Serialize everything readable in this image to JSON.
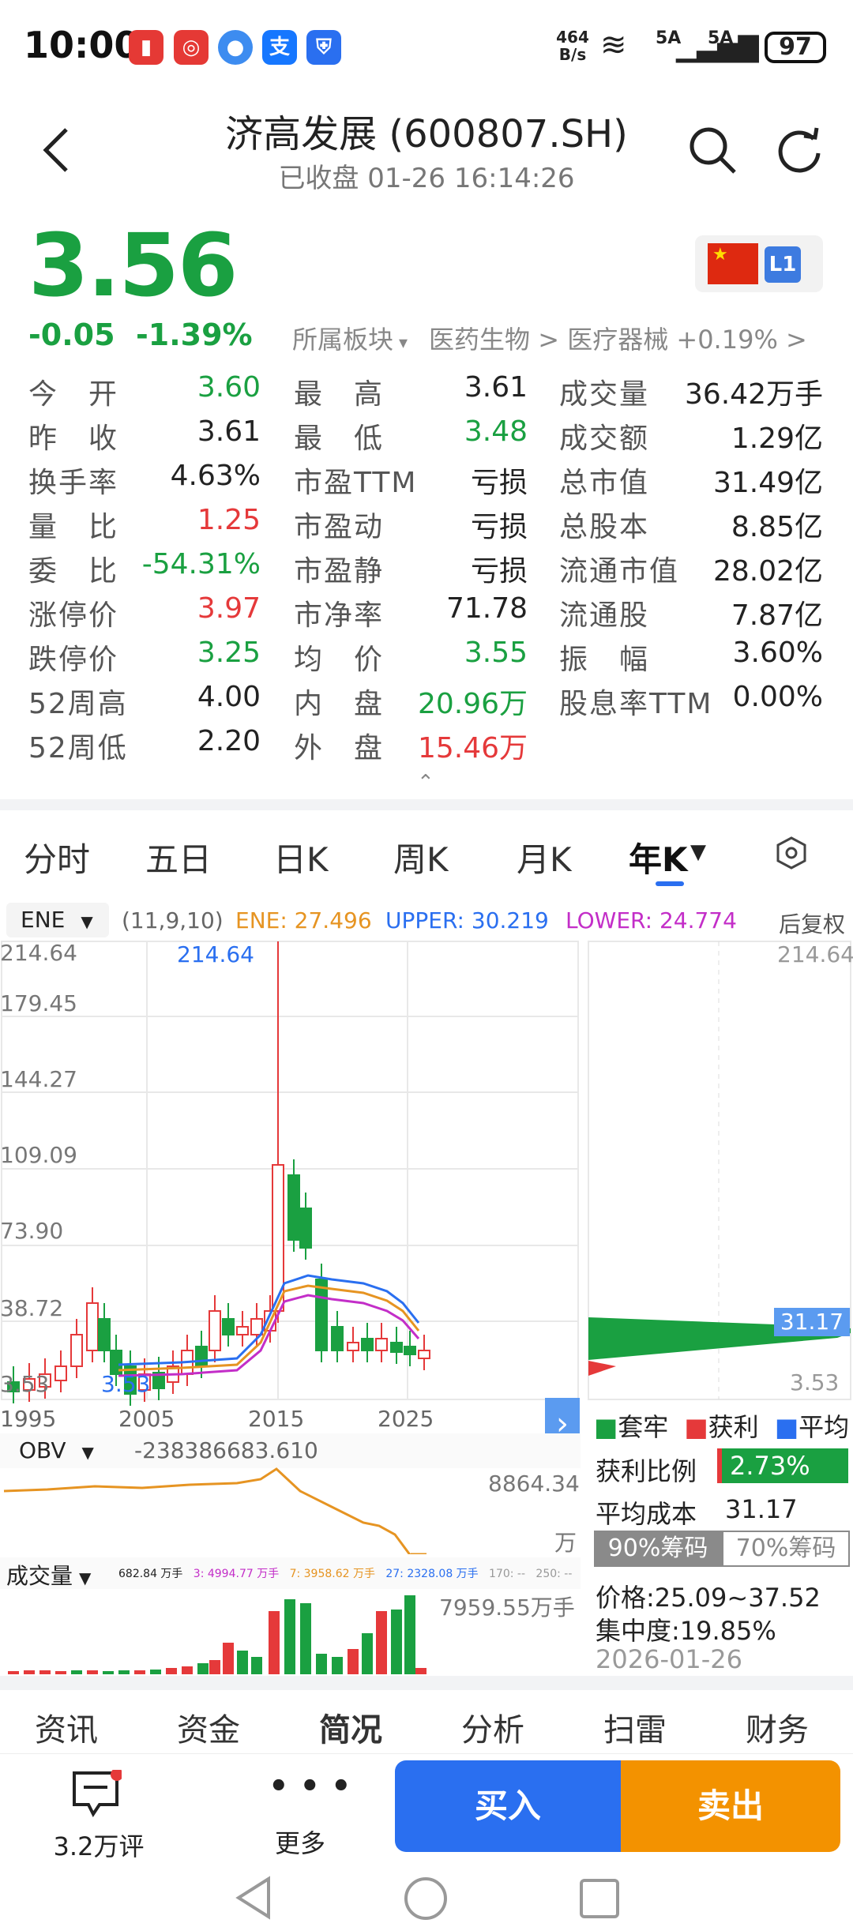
{
  "status": {
    "time": "10:00",
    "net": "464 B/s",
    "sig1": "5A",
    "sig2": "5A",
    "battery": "97",
    "wifi": "6"
  },
  "header": {
    "title": "济高发展 (600807.SH)",
    "subtitle": "已收盘 01-26 16:14:26"
  },
  "quote": {
    "price": "3.56",
    "change": "-0.05",
    "change_pct": "-1.39%",
    "sector_label": "所属板块",
    "sector": "医药生物 > 医疗器械 +0.19% >",
    "level": "L1"
  },
  "stats": [
    [
      {
        "l": "今　开",
        "v": "3.60",
        "c": "green"
      },
      {
        "l": "最　高",
        "v": "3.61",
        "c": "dark"
      },
      {
        "l": "成交量",
        "v": "36.42万手",
        "c": "dark"
      }
    ],
    [
      {
        "l": "昨　收",
        "v": "3.61",
        "c": "dark"
      },
      {
        "l": "最　低",
        "v": "3.48",
        "c": "green"
      },
      {
        "l": "成交额",
        "v": "1.29亿",
        "c": "dark"
      }
    ],
    [
      {
        "l": "换手率",
        "v": "4.63%",
        "c": "dark"
      },
      {
        "l": "市盈TTM",
        "v": "亏损",
        "c": "dark"
      },
      {
        "l": "总市值",
        "v": "31.49亿",
        "c": "dark"
      }
    ],
    [
      {
        "l": "量　比",
        "v": "1.25",
        "c": "red"
      },
      {
        "l": "市盈动",
        "v": "亏损",
        "c": "dark"
      },
      {
        "l": "总股本",
        "v": "8.85亿",
        "c": "dark"
      }
    ],
    [
      {
        "l": "委　比",
        "v": "-54.31%",
        "c": "green"
      },
      {
        "l": "市盈静",
        "v": "亏损",
        "c": "dark"
      },
      {
        "l": "流通市值",
        "v": "28.02亿",
        "c": "dark"
      }
    ],
    [
      {
        "l": "涨停价",
        "v": "3.97",
        "c": "red"
      },
      {
        "l": "市净率",
        "v": "71.78",
        "c": "dark"
      },
      {
        "l": "流通股",
        "v": "7.87亿",
        "c": "dark"
      }
    ],
    [
      {
        "l": "跌停价",
        "v": "3.25",
        "c": "green"
      },
      {
        "l": "均　价",
        "v": "3.55",
        "c": "green"
      },
      {
        "l": "振　幅",
        "v": "3.60%",
        "c": "dark"
      }
    ],
    [
      {
        "l": "52周高",
        "v": "4.00",
        "c": "dark"
      },
      {
        "l": "内　盘",
        "v": "20.96万",
        "c": "green"
      },
      {
        "l": "股息率TTM",
        "v": "0.00%",
        "c": "dark"
      }
    ],
    [
      {
        "l": "52周低",
        "v": "2.20",
        "c": "dark"
      },
      {
        "l": "外　盘",
        "v": "15.46万",
        "c": "red"
      },
      {
        "l": "",
        "v": "",
        "c": "dark"
      }
    ]
  ],
  "tabs": [
    "分时",
    "五日",
    "日K",
    "周K",
    "月K",
    "年K"
  ],
  "indicator": {
    "name": "ENE",
    "params": "(11,9,10)",
    "ene": "ENE: 27.496",
    "upper": "UPPER: 30.219",
    "lower": "LOWER: 24.774",
    "adjust": "后复权"
  },
  "chart_axis": {
    "y_ticks": [
      "214.64",
      "179.45",
      "144.27",
      "109.09",
      "73.90",
      "38.72",
      "3.53"
    ],
    "x_ticks": [
      "1995",
      "2005",
      "2015",
      "2025"
    ],
    "max_label": "214.64",
    "min_label": "3.53",
    "right_top": "214.64",
    "right_avg": "31.17",
    "right_low": "3.53"
  },
  "chip": {
    "legend": [
      "套牢",
      "获利",
      "平均"
    ],
    "profit_label": "获利比例",
    "profit": "2.73%",
    "avg_label": "平均成本",
    "avg": "31.17",
    "tab90": "90%筹码",
    "tab70": "70%筹码",
    "range": "价格:25.09~37.52",
    "conc": "集中度:19.85%",
    "date": "2026-01-26"
  },
  "obv": {
    "name": "OBV",
    "value": "-238386683.610",
    "right": "8864.34",
    "unit": "万"
  },
  "volume": {
    "name": "成交量",
    "v1": "682.84 万手",
    "v2": "3: 4994.77 万手",
    "v3": "7: 3958.62 万手",
    "v4": "27: 2328.08 万手",
    "v5": "170: --",
    "v6": "250: --",
    "max": "7959.55万手"
  },
  "bottom_tabs": [
    "资讯",
    "资金",
    "简况",
    "分析",
    "扫雷",
    "财务"
  ],
  "actions": {
    "comments": "3.2万评",
    "more": "更多",
    "buy": "买入",
    "sell": "卖出"
  },
  "chart_data": {
    "type": "candlestick",
    "x": [
      "1995",
      "2005",
      "2015",
      "2025"
    ],
    "ylim": [
      3.53,
      214.64
    ],
    "high_label": "214.64",
    "low_label": "3.53"
  }
}
